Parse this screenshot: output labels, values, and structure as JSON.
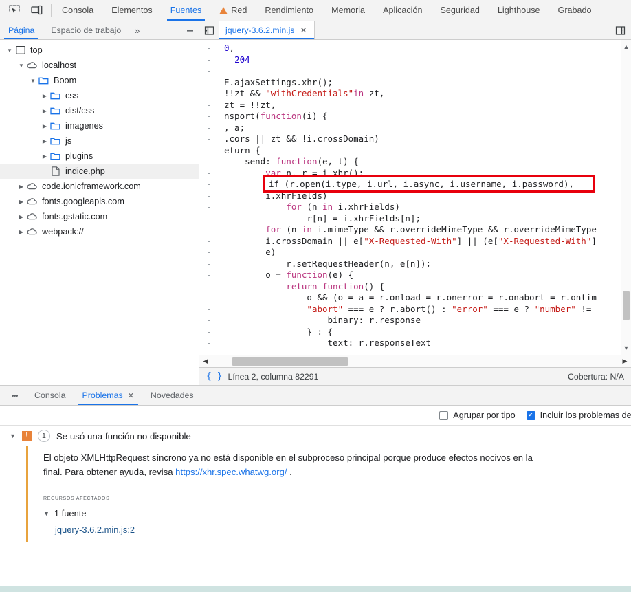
{
  "toolbar": {
    "inspect_icon": "inspect-element-icon",
    "device_icon": "device-toolbar-icon"
  },
  "main_tabs": [
    {
      "label": "Consola",
      "active": false,
      "warn": false
    },
    {
      "label": "Elementos",
      "active": false,
      "warn": false
    },
    {
      "label": "Fuentes",
      "active": true,
      "warn": false
    },
    {
      "label": "Red",
      "active": false,
      "warn": true
    },
    {
      "label": "Rendimiento",
      "active": false,
      "warn": false
    },
    {
      "label": "Memoria",
      "active": false,
      "warn": false
    },
    {
      "label": "Aplicación",
      "active": false,
      "warn": false
    },
    {
      "label": "Seguridad",
      "active": false,
      "warn": false
    },
    {
      "label": "Lighthouse",
      "active": false,
      "warn": false
    },
    {
      "label": "Grabado",
      "active": false,
      "warn": false
    }
  ],
  "nav_pane": {
    "tabs": [
      {
        "label": "Página",
        "active": true
      },
      {
        "label": "Espacio de trabajo",
        "active": false
      }
    ],
    "more_label": "»",
    "tree": [
      {
        "label": "top",
        "indent": 0,
        "state": "open",
        "icon": "frame-icon",
        "selected": false
      },
      {
        "label": "localhost",
        "indent": 1,
        "state": "open",
        "icon": "cloud-icon",
        "selected": false
      },
      {
        "label": "Boom",
        "indent": 2,
        "state": "open",
        "icon": "folder-icon",
        "selected": false
      },
      {
        "label": "css",
        "indent": 3,
        "state": "closed",
        "icon": "folder-icon",
        "selected": false
      },
      {
        "label": "dist/css",
        "indent": 3,
        "state": "closed",
        "icon": "folder-icon",
        "selected": false
      },
      {
        "label": "imagenes",
        "indent": 3,
        "state": "closed",
        "icon": "folder-icon",
        "selected": false
      },
      {
        "label": "js",
        "indent": 3,
        "state": "closed",
        "icon": "folder-icon",
        "selected": false
      },
      {
        "label": "plugins",
        "indent": 3,
        "state": "closed",
        "icon": "folder-icon",
        "selected": false
      },
      {
        "label": "indice.php",
        "indent": 3,
        "state": "none",
        "icon": "file-icon",
        "selected": true
      },
      {
        "label": "code.ionicframework.com",
        "indent": 1,
        "state": "closed",
        "icon": "cloud-icon",
        "selected": false
      },
      {
        "label": "fonts.googleapis.com",
        "indent": 1,
        "state": "closed",
        "icon": "cloud-icon",
        "selected": false
      },
      {
        "label": "fonts.gstatic.com",
        "indent": 1,
        "state": "closed",
        "icon": "cloud-icon",
        "selected": false
      },
      {
        "label": "webpack://",
        "indent": 1,
        "state": "closed",
        "icon": "cloud-icon",
        "selected": false
      }
    ]
  },
  "editor": {
    "tab_label": "jquery-3.6.2.min.js",
    "tab_close": "✕",
    "gutter_mark": "-",
    "lines": [
      "0,",
      "  204",
      "",
      "E.ajaxSettings.xhr();",
      "!!zt && \"withCredentials\"in zt,",
      "zt = !!zt,",
      "nsport(function(i) {",
      ", a;",
      ".cors || zt && !i.crossDomain)",
      "eturn {",
      "    send: function(e, t) {",
      "        var n, r = i.xhr();",
      "        if (r.open(i.type, i.url, i.async, i.username, i.password),",
      "        i.xhrFields)",
      "            for (n in i.xhrFields)",
      "                r[n] = i.xhrFields[n];",
      "        for (n in i.mimeType && r.overrideMimeType && r.overrideMimeType",
      "        i.crossDomain || e[\"X-Requested-With\"] || (e[\"X-Requested-With\"]",
      "        e)",
      "            r.setRequestHeader(n, e[n]);",
      "        o = function(e) {",
      "            return function() {",
      "                o && (o = a = r.onload = r.onerror = r.onabort = r.ontim",
      "                \"abort\" === e ? r.abort() : \"error\" === e ? \"number\" != ",
      "                    binary: r.response",
      "                } : {",
      "                    text: r.responseText"
    ],
    "highlight_text": "if (r.open(i.type, i.url, i.async, i.username, i.password),",
    "highlight_color": "#e8000d",
    "status_left": "Línea 2, columna 82291",
    "status_right": "Cobertura: N/A"
  },
  "drawer": {
    "tabs": [
      {
        "label": "Consola",
        "active": false,
        "closable": false
      },
      {
        "label": "Problemas",
        "active": true,
        "closable": true
      },
      {
        "label": "Novedades",
        "active": false,
        "closable": false
      }
    ],
    "filters": [
      {
        "label": "Agrupar por tipo",
        "checked": false
      },
      {
        "label": "Incluir los problemas de las c",
        "checked": true
      }
    ],
    "issue": {
      "title": "Se usó una función no disponible",
      "count": "1",
      "severity_icon": "warning-icon",
      "description_before": "El objeto XMLHttpRequest síncrono ya no está disponible en el subproceso principal porque produce efectos nocivos en la",
      "description_middle": "final. Para obtener ayuda, revisa",
      "link": "https://xhr.spec.whatwg.org/",
      "description_after": ".",
      "affected_label": "Recursos afectados",
      "sources_toggle": "1 fuente",
      "source_link": "jquery-3.6.2.min.js:2"
    }
  }
}
